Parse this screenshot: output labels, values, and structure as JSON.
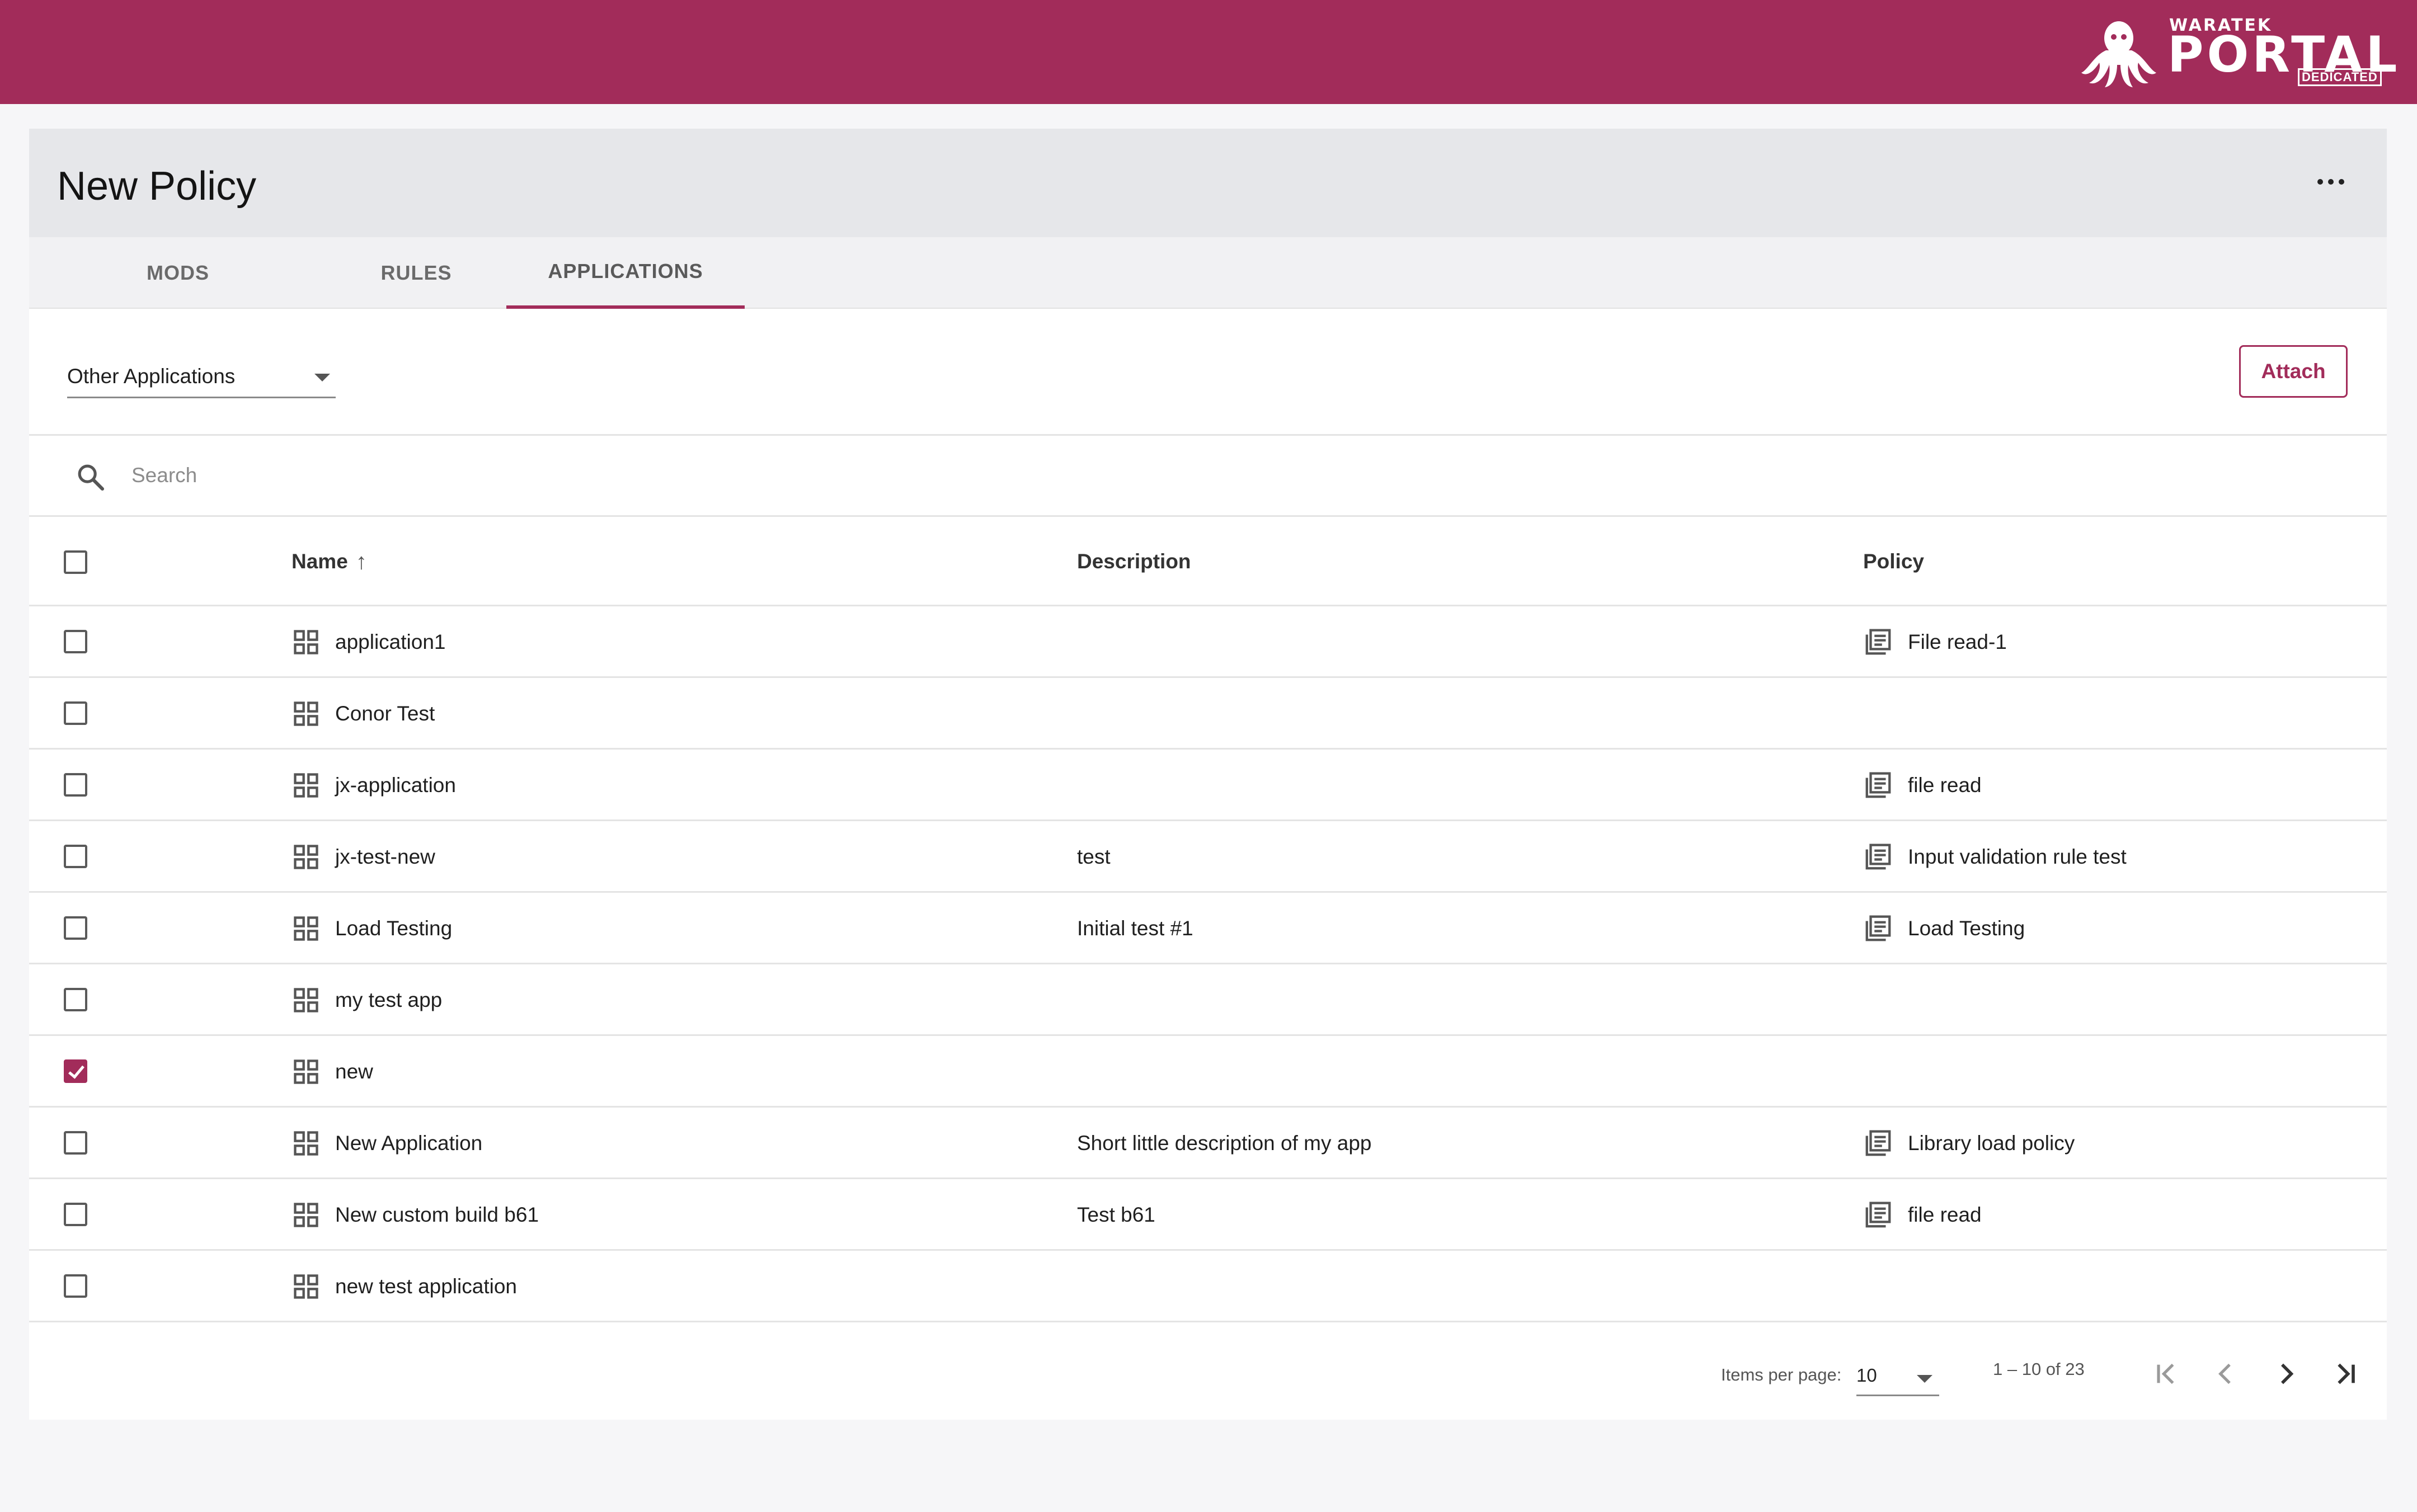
{
  "header": {
    "brand_small": "WARATEK",
    "brand_big": "PORTAL",
    "brand_tag": "DEDICATED",
    "accent_color": "#a22c5a"
  },
  "page": {
    "title": "New Policy",
    "more_icon": "more-horizontal-icon"
  },
  "tabs": [
    {
      "label": "MODS",
      "active": false
    },
    {
      "label": "RULES",
      "active": false
    },
    {
      "label": "APPLICATIONS",
      "active": true
    }
  ],
  "filter": {
    "selected": "Other Applications",
    "attach_label": "Attach"
  },
  "search": {
    "placeholder": "Search"
  },
  "table": {
    "columns": {
      "name": "Name",
      "description": "Description",
      "policy": "Policy"
    },
    "sort_indicator": "↑",
    "rows": [
      {
        "name": "application1",
        "description": "",
        "policy": "File read-1",
        "checked": false
      },
      {
        "name": "Conor Test",
        "description": "",
        "policy": "",
        "checked": false
      },
      {
        "name": "jx-application",
        "description": "",
        "policy": "file read",
        "checked": false
      },
      {
        "name": "jx-test-new",
        "description": "test",
        "policy": "Input validation rule test",
        "checked": false
      },
      {
        "name": "Load Testing",
        "description": "Initial test #1",
        "policy": "Load Testing",
        "checked": false
      },
      {
        "name": "my test app",
        "description": "",
        "policy": "",
        "checked": false
      },
      {
        "name": "new",
        "description": "",
        "policy": "",
        "checked": true
      },
      {
        "name": "New Application",
        "description": "Short little description of my app",
        "policy": "Library load policy",
        "checked": false
      },
      {
        "name": "New custom build b61",
        "description": "Test b61",
        "policy": "file read",
        "checked": false
      },
      {
        "name": "new test application",
        "description": "",
        "policy": "",
        "checked": false
      }
    ]
  },
  "paginator": {
    "items_per_page_label": "Items per page:",
    "items_per_page": "10",
    "range": "1 – 10 of 23"
  }
}
